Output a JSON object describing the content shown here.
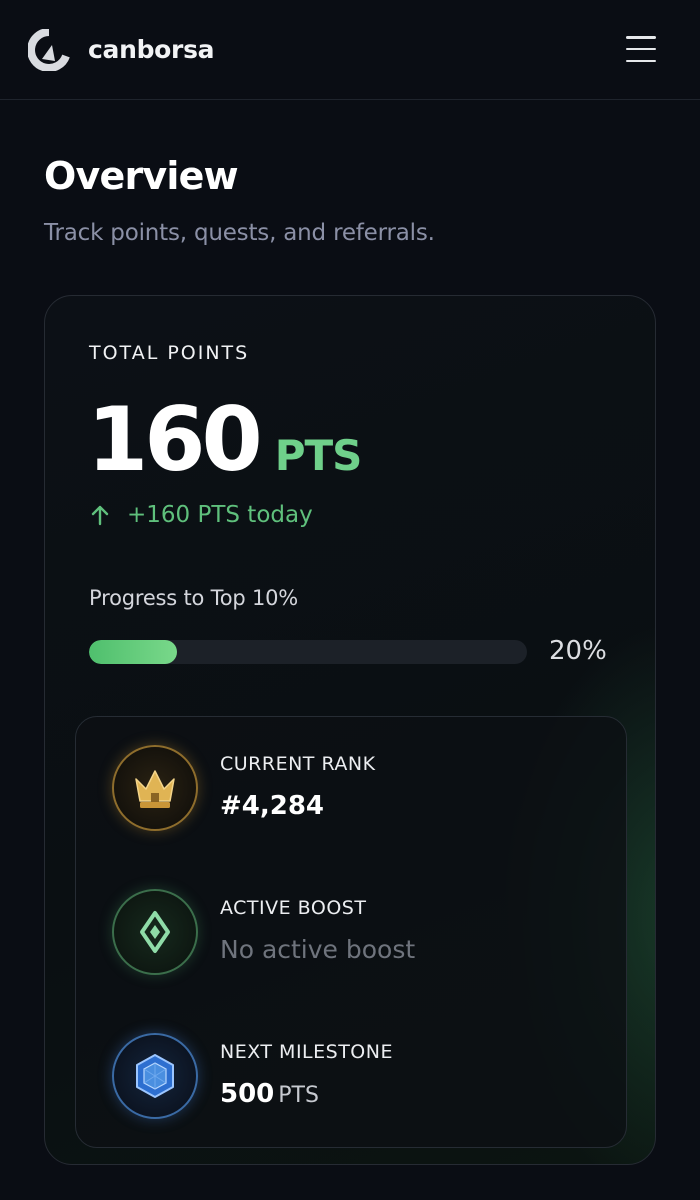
{
  "header": {
    "brand": "canborsa"
  },
  "page": {
    "title": "Overview",
    "subtitle": "Track points, quests, and referrals."
  },
  "points_card": {
    "label": "TOTAL POINTS",
    "value": "160",
    "unit": "PTS",
    "today": "+160 PTS today",
    "progress_label": "Progress to Top 10%",
    "progress_value": 0.2,
    "progress_text": "20%"
  },
  "stats": {
    "rank": {
      "label": "CURRENT RANK",
      "value": "#4,284"
    },
    "boost": {
      "label": "ACTIVE BOOST",
      "value": "No active boost"
    },
    "milestone": {
      "label": "NEXT MILESTONE",
      "value": "500",
      "unit": "PTS"
    }
  },
  "colors": {
    "background": "#0a0d14",
    "accent_green": "#6fd08a",
    "progress_fill": "#5cc976",
    "gold": "#e0b454",
    "blue": "#4a8fe0"
  },
  "icons": {
    "logo": "canborsa-logo-icon",
    "menu": "hamburger-menu-icon",
    "today": "arrow-up-icon",
    "rank": "crown-icon",
    "boost": "diamond-icon",
    "milestone": "gem-icon"
  }
}
